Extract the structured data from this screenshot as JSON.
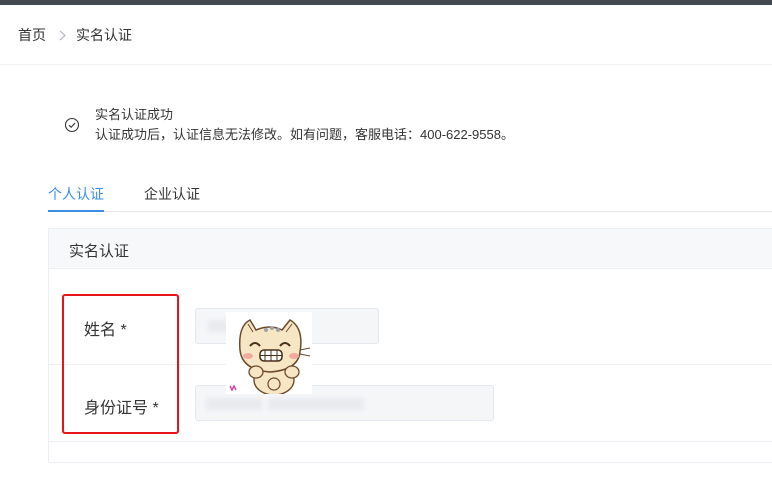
{
  "breadcrumb": {
    "home": "首页",
    "current": "实名认证"
  },
  "notice": {
    "icon": "check-circle-icon",
    "title": "实名认证成功",
    "description": "认证成功后，认证信息无法修改。如有问题，客服电话：400-622-9558。"
  },
  "tabs": [
    {
      "label": "个人认证",
      "active": true
    },
    {
      "label": "企业认证",
      "active": false
    }
  ],
  "card": {
    "title": "实名认证",
    "fields": {
      "name_label": "姓名 *",
      "id_label": "身份证号 *"
    }
  },
  "colors": {
    "accent": "#3a8ee6",
    "highlight": "#e8141b",
    "topbar": "#444a52"
  }
}
